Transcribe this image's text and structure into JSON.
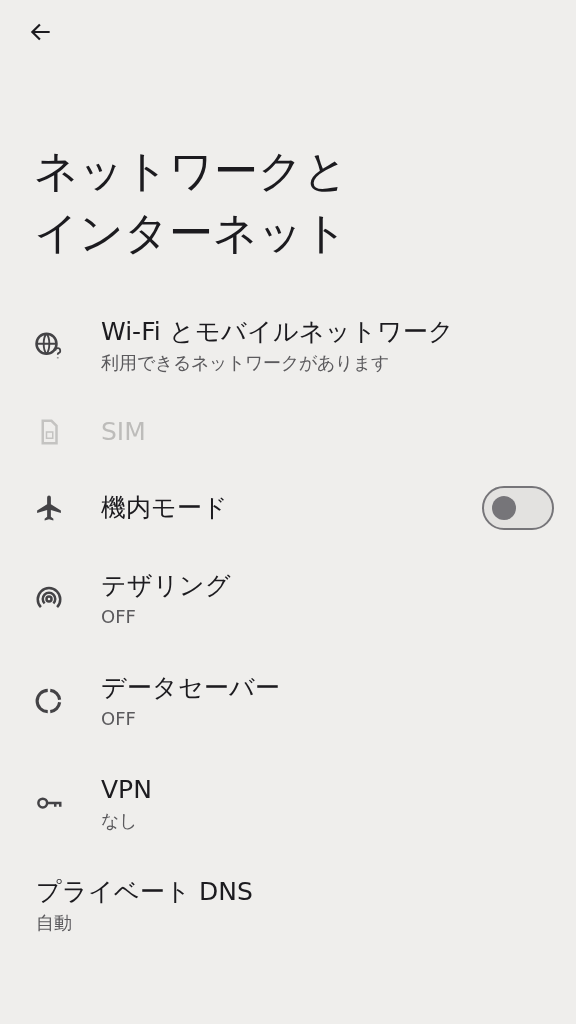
{
  "title_lines": [
    "ネットワークと",
    "インターネット"
  ],
  "items": [
    {
      "kind": "globe",
      "title": "Wi-Fi とモバイルネットワーク",
      "subtitle": "利用できるネットワークがあります",
      "disabled": false
    },
    {
      "kind": "sim",
      "title": "SIM",
      "disabled": true
    },
    {
      "kind": "airplane",
      "title": "機内モード",
      "disabled": false,
      "toggle": {
        "on": false
      }
    },
    {
      "kind": "tether",
      "title": "テザリング",
      "subtitle": "OFF",
      "disabled": false
    },
    {
      "kind": "datasaver",
      "title": "データセーバー",
      "subtitle": "OFF",
      "disabled": false
    },
    {
      "kind": "key",
      "title": "VPN",
      "subtitle": "なし",
      "disabled": false
    },
    {
      "kind": "plain",
      "title": "プライベート DNS",
      "subtitle": "自動",
      "disabled": false
    }
  ]
}
